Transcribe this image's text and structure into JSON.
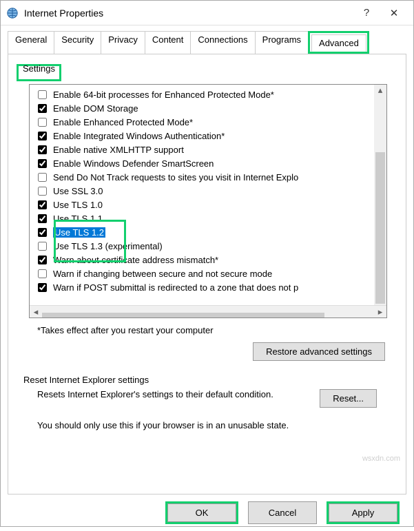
{
  "window": {
    "title": "Internet Properties"
  },
  "tabs": [
    "General",
    "Security",
    "Privacy",
    "Content",
    "Connections",
    "Programs",
    "Advanced"
  ],
  "group": {
    "label": "Settings"
  },
  "settings": {
    "items": [
      {
        "label": "Enable 64-bit processes for Enhanced Protected Mode*",
        "checked": false
      },
      {
        "label": "Enable DOM Storage",
        "checked": true
      },
      {
        "label": "Enable Enhanced Protected Mode*",
        "checked": false
      },
      {
        "label": "Enable Integrated Windows Authentication*",
        "checked": true
      },
      {
        "label": "Enable native XMLHTTP support",
        "checked": true
      },
      {
        "label": "Enable Windows Defender SmartScreen",
        "checked": true
      },
      {
        "label": "Send Do Not Track requests to sites you visit in Internet Explo",
        "checked": false
      },
      {
        "label": "Use SSL 3.0",
        "checked": false
      },
      {
        "label": "Use TLS 1.0",
        "checked": true
      },
      {
        "label": "Use TLS 1.1",
        "checked": true
      },
      {
        "label": "Use TLS 1.2",
        "checked": true,
        "selected": true
      },
      {
        "label": "Use TLS 1.3 (experimental)",
        "checked": false
      },
      {
        "label": "Warn about certificate address mismatch*",
        "checked": true
      },
      {
        "label": "Warn if changing between secure and not secure mode",
        "checked": false
      },
      {
        "label": "Warn if POST submittal is redirected to a zone that does not p",
        "checked": true
      }
    ]
  },
  "note": "*Takes effect after you restart your computer",
  "restore_btn": "Restore advanced settings",
  "reset": {
    "title": "Reset Internet Explorer settings",
    "text": "Resets Internet Explorer's settings to their default condition.",
    "btn": "Reset...",
    "warn": "You should only use this if your browser is in an unusable state."
  },
  "footer": {
    "ok": "OK",
    "cancel": "Cancel",
    "apply": "Apply"
  },
  "watermark": "wsxdn.com"
}
